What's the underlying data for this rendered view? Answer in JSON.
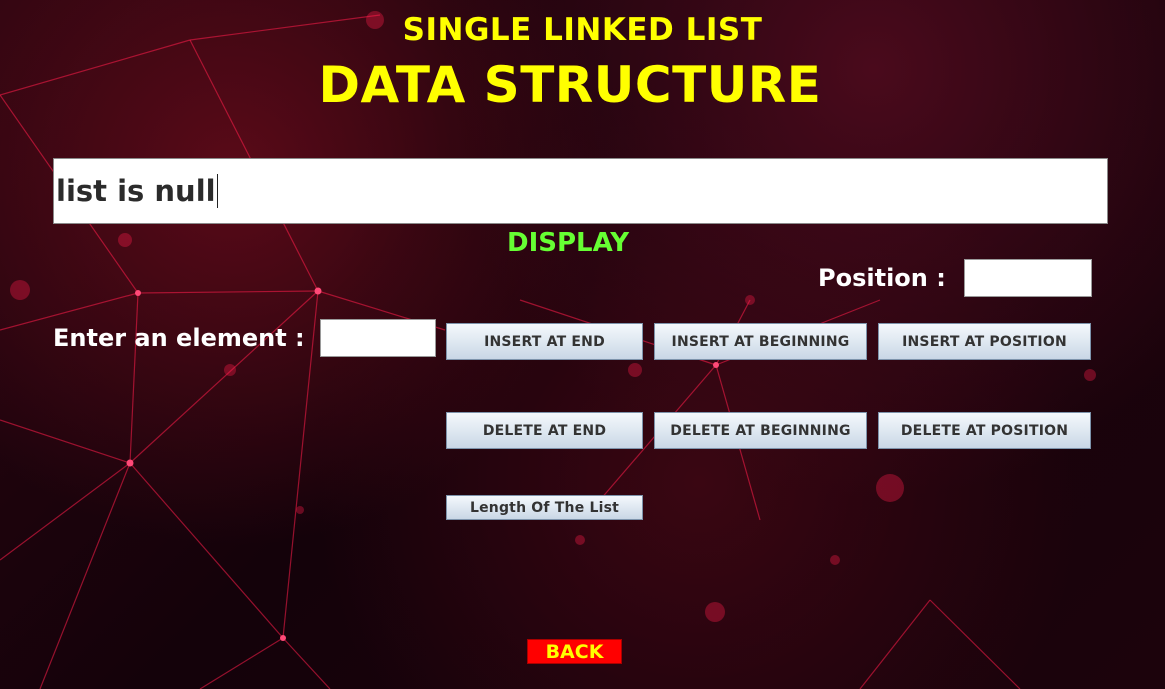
{
  "header": {
    "subtitle": "SINGLE LINKED LIST",
    "title": "DATA STRUCTURE"
  },
  "display": {
    "value": "list is null",
    "label": "DISPLAY"
  },
  "position": {
    "label": "Position :",
    "value": ""
  },
  "element": {
    "label": "Enter an element :",
    "value": ""
  },
  "buttons": {
    "insert_end": "INSERT AT END",
    "insert_beginning": "INSERT AT BEGINNING",
    "insert_position": "INSERT AT POSITION",
    "delete_end": "DELETE AT END",
    "delete_beginning": "DELETE AT BEGINNING",
    "delete_position": "DELETE AT POSITION",
    "length": "Length Of The List",
    "back": "BACK"
  },
  "colors": {
    "title": "#ffff00",
    "display_label": "#66ff33",
    "back_bg": "#ff0000",
    "back_text": "#ffff00",
    "background": "#1a030b"
  }
}
